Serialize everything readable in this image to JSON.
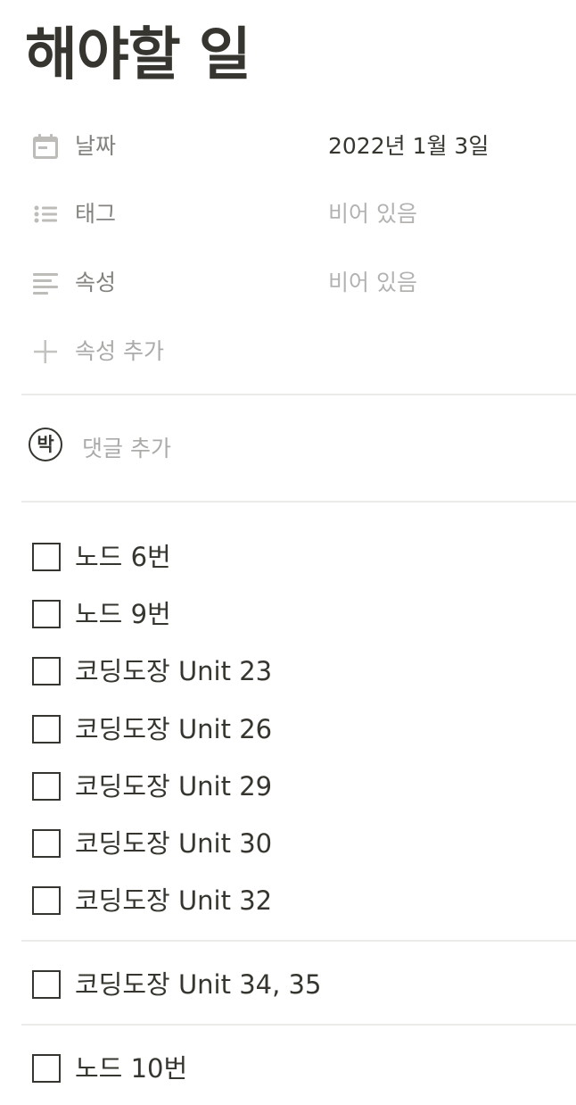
{
  "page": {
    "title": "해야할 일"
  },
  "properties": {
    "date": {
      "label": "날짜",
      "value": "2022년 1월 3일",
      "icon": "calendar-icon"
    },
    "tags": {
      "label": "태그",
      "value": "비어 있음",
      "icon": "list-icon"
    },
    "attribute": {
      "label": "속성",
      "value": "비어 있음",
      "icon": "text-lines-icon"
    },
    "add": {
      "label": "속성 추가",
      "icon": "plus-icon"
    }
  },
  "comment": {
    "avatar_text": "박",
    "placeholder": "댓글 추가"
  },
  "todos": [
    {
      "text": "노드 6번",
      "checked": false
    },
    {
      "text": "노드 9번",
      "checked": false
    },
    {
      "text": "코딩도장 Unit 23",
      "checked": false
    },
    {
      "text": "코딩도장 Unit 26",
      "checked": false
    },
    {
      "text": "코딩도장 Unit 29",
      "checked": false
    },
    {
      "text": "코딩도장 Unit 30",
      "checked": false
    },
    {
      "text": "코딩도장 Unit 32",
      "checked": false
    },
    {
      "text": "코딩도장 Unit 34, 35",
      "checked": false
    },
    {
      "text": "노드 10번",
      "checked": false
    }
  ],
  "colors": {
    "text": "#37352f",
    "muted": "#9b9a97",
    "divider": "#ebebea"
  }
}
